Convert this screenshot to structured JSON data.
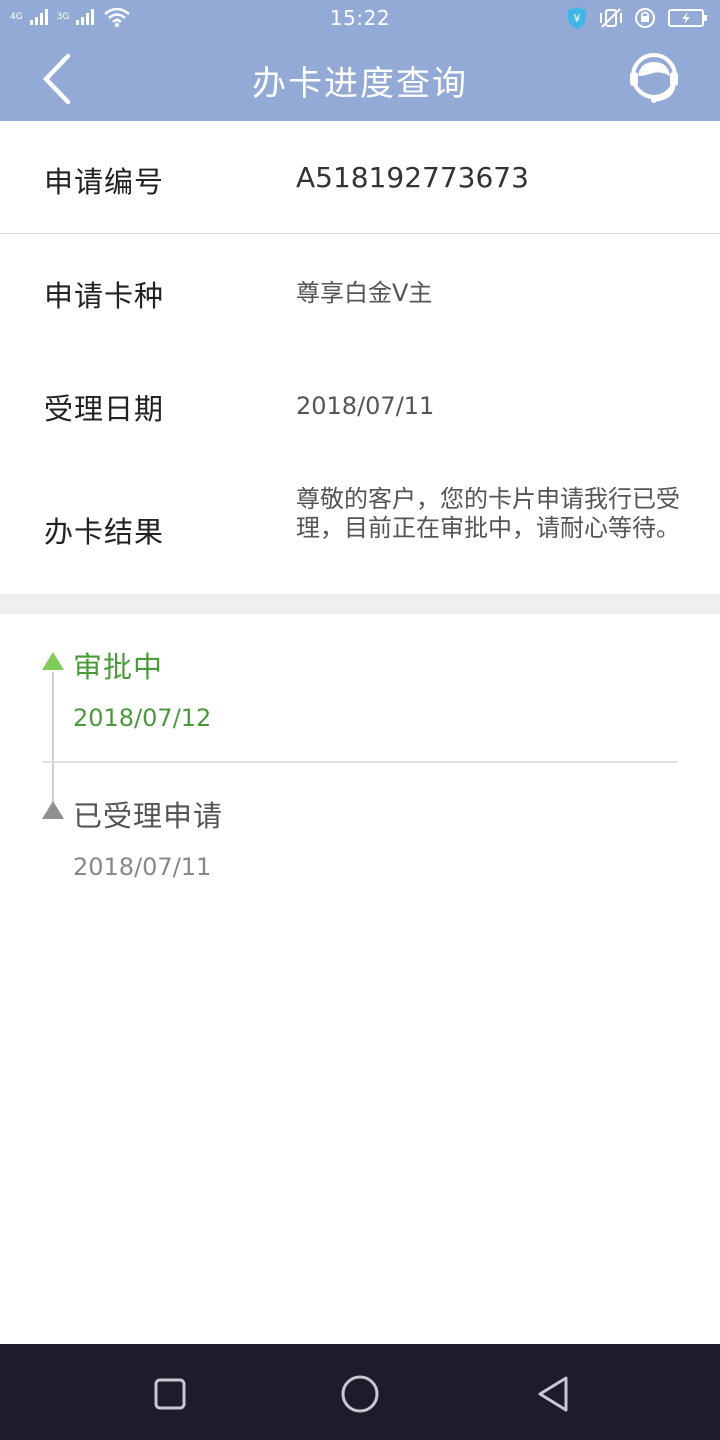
{
  "status_bar": {
    "time": "15:22",
    "network_1": "4G",
    "network_2": "3G"
  },
  "header": {
    "title": "办卡进度查询",
    "back_icon": "chevron-left-icon",
    "service_icon": "customer-service-headset-icon"
  },
  "details": {
    "application_number_label": "申请编号",
    "application_number_value": "A518192773673",
    "card_type_label": "申请卡种",
    "card_type_value": "尊享白金V主",
    "accept_date_label": "受理日期",
    "accept_date_value": "2018/07/11",
    "result_label": "办卡结果",
    "result_value": "尊敬的客户，您的卡片申请我行已受理，目前正在审批中，请耐心等待。"
  },
  "timeline": [
    {
      "status": "审批中",
      "date": "2018/07/12",
      "color": "#4a9a3c"
    },
    {
      "status": "已受理申请",
      "date": "2018/07/11",
      "color": "#888888"
    }
  ],
  "colors": {
    "header_bg": "#94aad6",
    "active_green": "#4a9a3c",
    "nav_bg": "#1c1c2c"
  }
}
